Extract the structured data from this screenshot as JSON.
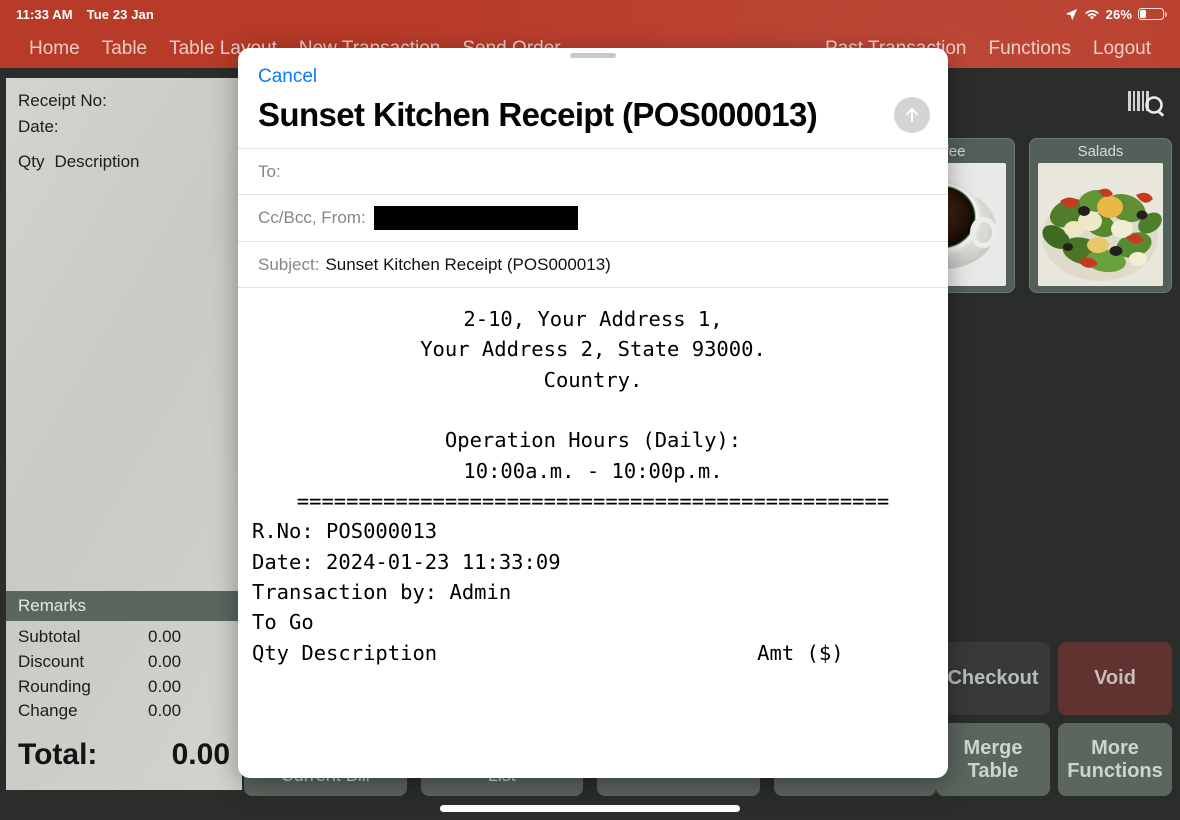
{
  "status_bar": {
    "time": "11:33 AM",
    "date": "Tue 23 Jan",
    "battery_percent": "26%",
    "battery_level": 26,
    "icons": [
      "location-arrow-icon",
      "wifi-icon",
      "battery-icon"
    ]
  },
  "nav": {
    "items": [
      {
        "label": "Home"
      },
      {
        "label": "Table"
      },
      {
        "label": "Table Layout"
      },
      {
        "label": "New Transaction"
      },
      {
        "label": "Send Order"
      },
      {
        "label": "Past Transaction"
      },
      {
        "label": "Functions"
      },
      {
        "label": "Logout"
      }
    ]
  },
  "order_panel": {
    "receipt_no_label": "Receipt No:",
    "date_label": "Date:",
    "qty_label": "Qty",
    "description_label": "Description",
    "remarks_label": "Remarks",
    "summary_rows": [
      {
        "label": "Subtotal",
        "value": "0.00"
      },
      {
        "label": "Discount",
        "value": "0.00"
      },
      {
        "label": "Rounding",
        "value": "0.00"
      },
      {
        "label": "Change",
        "value": "0.00"
      }
    ],
    "total_label": "Total:",
    "total_value": "0.00"
  },
  "toolbar": {
    "scan_icon": "barcode-search-icon",
    "buttons": [
      {
        "label": "Current Bill"
      },
      {
        "label": "List"
      },
      {
        "label": ""
      },
      {
        "label": ""
      }
    ]
  },
  "categories": [
    {
      "label": "Coffee",
      "image": "coffee-cup-photo"
    },
    {
      "label": "Salads",
      "image": "salad-bowl-photo"
    }
  ],
  "actions": [
    {
      "label": "Checkout",
      "color": "#383a37"
    },
    {
      "label": "Void",
      "color": "#5e3330"
    },
    {
      "label": "Merge Table",
      "color": "#5b665f"
    },
    {
      "label": "More\nFunctions",
      "color": "#5b665f"
    }
  ],
  "action_more_line1": "More",
  "action_more_line2": "Functions",
  "modal": {
    "cancel_label": "Cancel",
    "title": "Sunset Kitchen Receipt (POS000013)",
    "send_icon": "arrow-up-send-icon",
    "to_label": "To:",
    "to_value": "",
    "ccbcc_label": "Cc/Bcc, From:",
    "ccbcc_value_redacted": true,
    "subject_label": "Subject:",
    "subject_value": "Sunset Kitchen Receipt (POS000013)",
    "receipt_body_center": "2-10, Your Address 1,\nYour Address 2, State 93000.\nCountry.\n\nOperation Hours (Daily):\n10:00a.m. - 10:00p.m.",
    "receipt_divider": "================================================",
    "receipt_body_left": "R.No: POS000013\nDate: 2024-01-23 11:33:09\nTransaction by: Admin\nTo Go",
    "receipt_table_header_left": "Qty Description",
    "receipt_table_header_right": "Amt ($)"
  },
  "colors": {
    "header_red": "#b83a28",
    "accent_blue": "#0a7bff",
    "panel_gray": "#cfcfcb",
    "dark_bg": "#2b2d2b",
    "button_green_gray": "#5b665f",
    "void_red": "#5e3330"
  }
}
